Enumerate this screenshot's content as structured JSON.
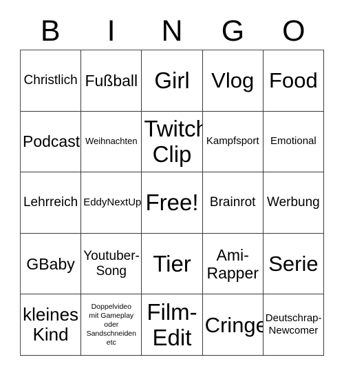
{
  "card": {
    "title": "BINGO",
    "header_letters": [
      "B",
      "I",
      "N",
      "G",
      "O"
    ],
    "colors": {
      "background": "#ffffff",
      "text": "#000000",
      "grid_line": "#3a3a3a"
    },
    "rows": [
      [
        {
          "text": "Christlich",
          "size": "s",
          "marked": false
        },
        {
          "text": "Fußball",
          "size": "m",
          "marked": false
        },
        {
          "text": "Girl",
          "size": "xxl",
          "marked": false
        },
        {
          "text": "Vlog",
          "size": "xl",
          "marked": false
        },
        {
          "text": "Food",
          "size": "xl",
          "marked": false
        }
      ],
      [
        {
          "text": "Podcast",
          "size": "m",
          "marked": false
        },
        {
          "text": "Weihnachten",
          "size": "xxs",
          "marked": false
        },
        {
          "text": "Twitch\nClip",
          "size": "xxl",
          "marked": false
        },
        {
          "text": "Kampfsport",
          "size": "xs",
          "marked": false
        },
        {
          "text": "Emotional",
          "size": "xs",
          "marked": false
        }
      ],
      [
        {
          "text": "Lehrreich",
          "size": "s",
          "marked": false
        },
        {
          "text": "EddyNextUp",
          "size": "xs",
          "marked": false
        },
        {
          "text": "Free!",
          "size": "xxl",
          "marked": false
        },
        {
          "text": "Brainrot",
          "size": "s",
          "marked": false
        },
        {
          "text": "Werbung",
          "size": "s",
          "marked": false
        }
      ],
      [
        {
          "text": "GBaby",
          "size": "m",
          "marked": false
        },
        {
          "text": "Youtuber-\nSong",
          "size": "s",
          "marked": false
        },
        {
          "text": "Tier",
          "size": "xxl",
          "marked": false
        },
        {
          "text": "Ami-\nRapper",
          "size": "m",
          "marked": false
        },
        {
          "text": "Serie",
          "size": "xl",
          "marked": false
        }
      ],
      [
        {
          "text": "kleines\nKind",
          "size": "l",
          "marked": false
        },
        {
          "text": "Doppelvideo\nmit Gameplay\noder\nSandschneiden\netc",
          "size": "tiny",
          "marked": false
        },
        {
          "text": "Film-\nEdit",
          "size": "xxl",
          "marked": false
        },
        {
          "text": "Cringe",
          "size": "xl",
          "marked": false
        },
        {
          "text": "Deutschrap-\nNewcomer",
          "size": "xs",
          "marked": false
        }
      ]
    ]
  }
}
